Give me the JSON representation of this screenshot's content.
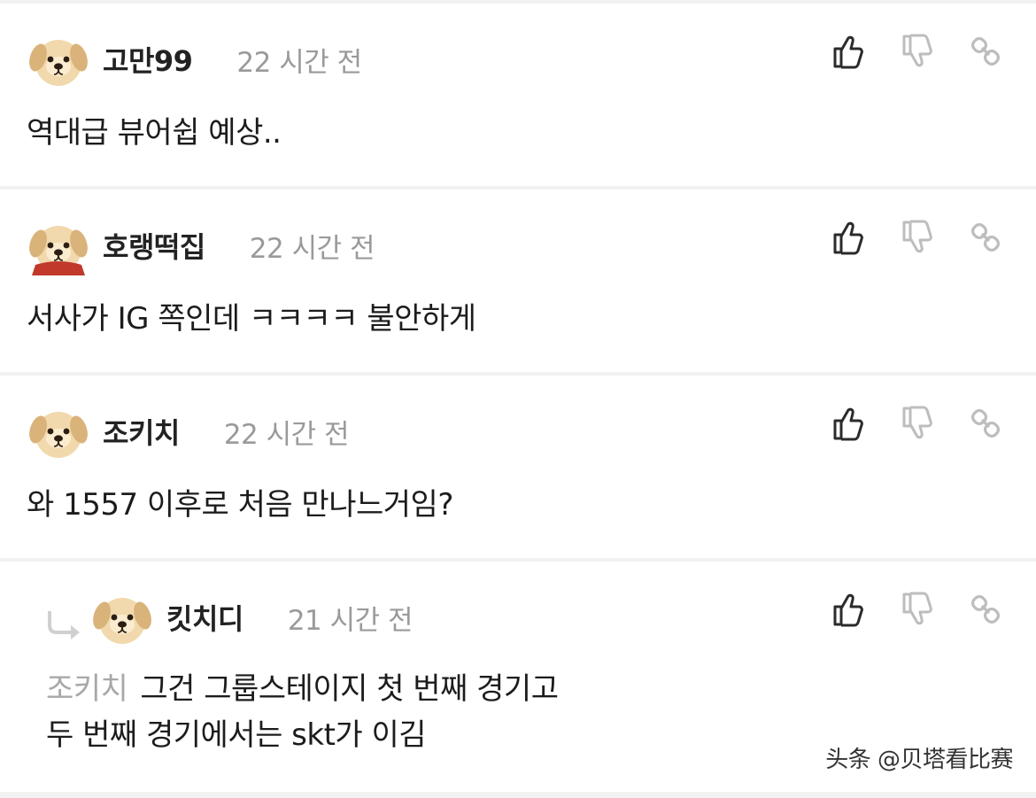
{
  "comments": [
    {
      "username": "고만99",
      "time": "22 시간 전",
      "text": "역대급 뷰어쉽 예상.."
    },
    {
      "username": "호랭떡집",
      "time": "22 시간 전",
      "text": "서사가 IG 쪽인데 ㅋㅋㅋㅋ 불안하게"
    },
    {
      "username": "조키치",
      "time": "22 시간 전",
      "text": "와 1557 이후로 처음 만나느거임?"
    },
    {
      "username": "킷치디",
      "time": "21 시간 전",
      "mention": "조키치",
      "line1": "그건 그룹스테이지 첫 번째 경기고",
      "line2": "두 번째 경기에서는 skt가 이김"
    }
  ],
  "icons": {
    "like": "thumbs-up-icon",
    "dislike": "thumbs-down-icon",
    "link": "link-icon",
    "reply": "reply-arrow-icon",
    "avatar": "puppy-avatar-icon"
  },
  "watermark": "头条 @贝塔看比赛",
  "colors": {
    "background": "#f2f2f2",
    "card": "#ffffff",
    "muted": "#9a9a9a",
    "text": "#1c1c1c"
  }
}
